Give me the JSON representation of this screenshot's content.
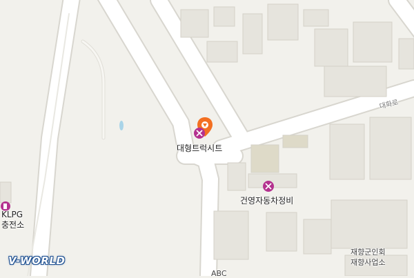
{
  "map": {
    "provider_logo": "V-WORLD",
    "street_label": "대화로",
    "pois": [
      {
        "name": "대형트럭시트",
        "icon": "wrench-screwdriver-icon",
        "selected": true
      },
      {
        "name": "건영자동차정비",
        "icon": "wrench-screwdriver-icon",
        "selected": false
      },
      {
        "name_line1": "KLPG",
        "name_line2": "충전소",
        "icon": "fuel-station-icon"
      }
    ],
    "buildings": [
      {
        "line1": "재향군인회",
        "line2": "재향사업소"
      }
    ],
    "cutoff_label": "ABC",
    "colors": {
      "background": "#f2f1ec",
      "road": "#ffffff",
      "building": "#e6e4dd",
      "poi_accent": "#b4318f",
      "selected_pin": "#f36f21",
      "water": "#a9d4e8"
    }
  }
}
